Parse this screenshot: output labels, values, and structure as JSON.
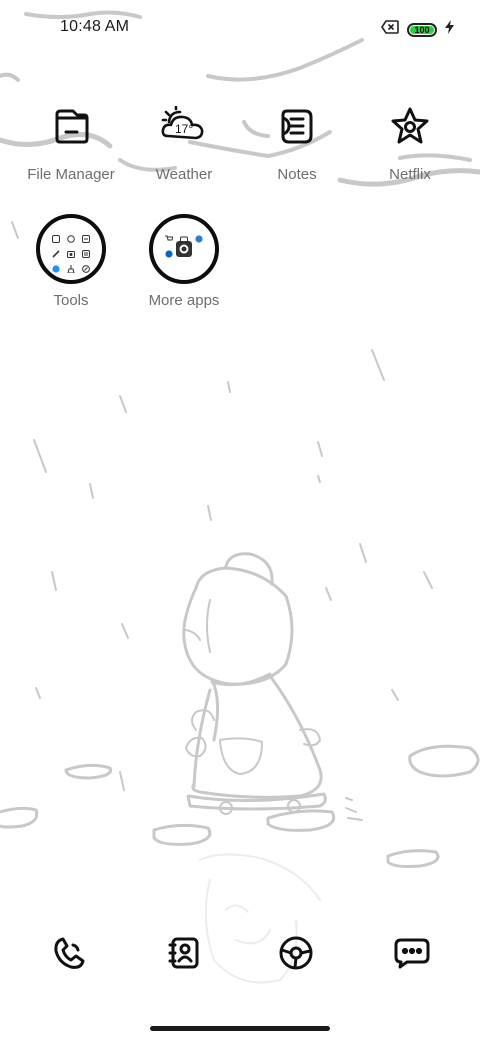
{
  "status_bar": {
    "time": "10:48 AM",
    "battery_level": 100,
    "battery_text": "100",
    "charging": true,
    "battery_color": "#2ecc40",
    "sim_icon": "no-sim-icon"
  },
  "home_apps": [
    {
      "label": "File Manager",
      "icon": "folder-box-icon"
    },
    {
      "label": "Weather",
      "icon": "sun-cloud-icon",
      "temperature": "17°"
    },
    {
      "label": "Notes",
      "icon": "notes-icon"
    },
    {
      "label": "Netflix",
      "icon": "star-icon"
    }
  ],
  "folders": [
    {
      "label": "Tools"
    },
    {
      "label": "More apps"
    }
  ],
  "dock": [
    {
      "icon": "phone-icon"
    },
    {
      "icon": "contacts-icon"
    },
    {
      "icon": "browser-icon"
    },
    {
      "icon": "messages-icon"
    }
  ],
  "colors": {
    "label": "#6e6e6e",
    "icon_stroke": "#111111",
    "wallpaper_stroke": "#c8c8c8"
  }
}
